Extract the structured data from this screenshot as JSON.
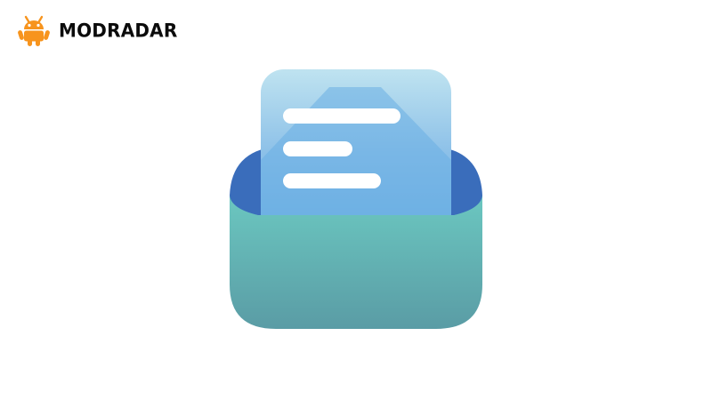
{
  "brand": {
    "name": "MODRADAR",
    "icon": "android-robot-icon",
    "accent": "#F7941D"
  },
  "illustration": {
    "icon": "mail-inbox-document-icon",
    "colors": {
      "document": "#6AAEE3",
      "document_top": "#BFE3F0",
      "envelope_back": "#3A6DBB",
      "envelope_front_top": "#6BC7C0",
      "envelope_front_bottom": "#5A9CA5",
      "lines": "#FFFFFF"
    }
  }
}
